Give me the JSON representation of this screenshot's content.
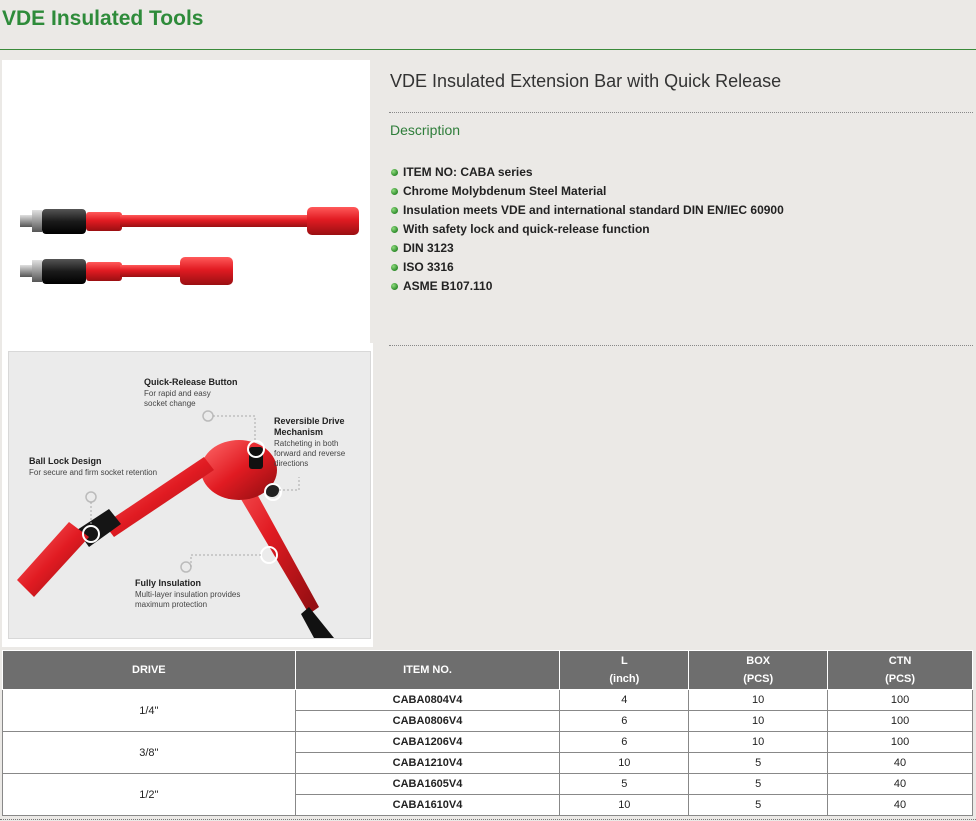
{
  "page": {
    "title": "VDE Insulated Tools"
  },
  "product": {
    "title": "VDE Insulated Extension Bar with Quick Release",
    "description_label": "Description",
    "features": [
      "ITEM NO: CABA series",
      "Chrome Molybdenum Steel Material",
      "Insulation meets VDE and international standard DIN EN/IEC 60900",
      "With safety lock and quick-release function",
      "DIN 3123",
      "ISO 3316",
      "ASME B107.110"
    ]
  },
  "diagram": {
    "quick_release_title": "Quick-Release Button",
    "quick_release_desc_1": "For rapid and easy",
    "quick_release_desc_2": "socket change",
    "reversible_title_1": "Reversible Drive",
    "reversible_title_2": "Mechanism",
    "reversible_desc_1": "Ratcheting in both",
    "reversible_desc_2": "forward and reverse",
    "reversible_desc_3": "directions",
    "ball_lock_title": "Ball Lock Design",
    "ball_lock_desc": "For secure and firm socket retention",
    "insulation_title": "Fully Insulation",
    "insulation_desc_1": "Multi-layer insulation provides",
    "insulation_desc_2": "maximum protection"
  },
  "table": {
    "headers": {
      "drive": "DRIVE",
      "item": "ITEM NO.",
      "l": "L",
      "l_unit": "(inch)",
      "box": "BOX",
      "box_unit": "(PCS)",
      "ctn": "CTN",
      "ctn_unit": "(PCS)"
    },
    "groups": [
      {
        "drive": "1/4\"",
        "rows": [
          {
            "item": "CABA0804V4",
            "l": "4",
            "box": "10",
            "ctn": "100"
          },
          {
            "item": "CABA0806V4",
            "l": "6",
            "box": "10",
            "ctn": "100"
          }
        ]
      },
      {
        "drive": "3/8\"",
        "rows": [
          {
            "item": "CABA1206V4",
            "l": "6",
            "box": "10",
            "ctn": "100"
          },
          {
            "item": "CABA1210V4",
            "l": "10",
            "box": "5",
            "ctn": "40"
          }
        ]
      },
      {
        "drive": "1/2\"",
        "rows": [
          {
            "item": "CABA1605V4",
            "l": "5",
            "box": "5",
            "ctn": "40"
          },
          {
            "item": "CABA1610V4",
            "l": "10",
            "box": "5",
            "ctn": "40"
          }
        ]
      }
    ]
  },
  "colors": {
    "brand_green": "#2e8b3a",
    "header_gray": "#6e6e6e",
    "insulation_red": "#e11b22"
  }
}
